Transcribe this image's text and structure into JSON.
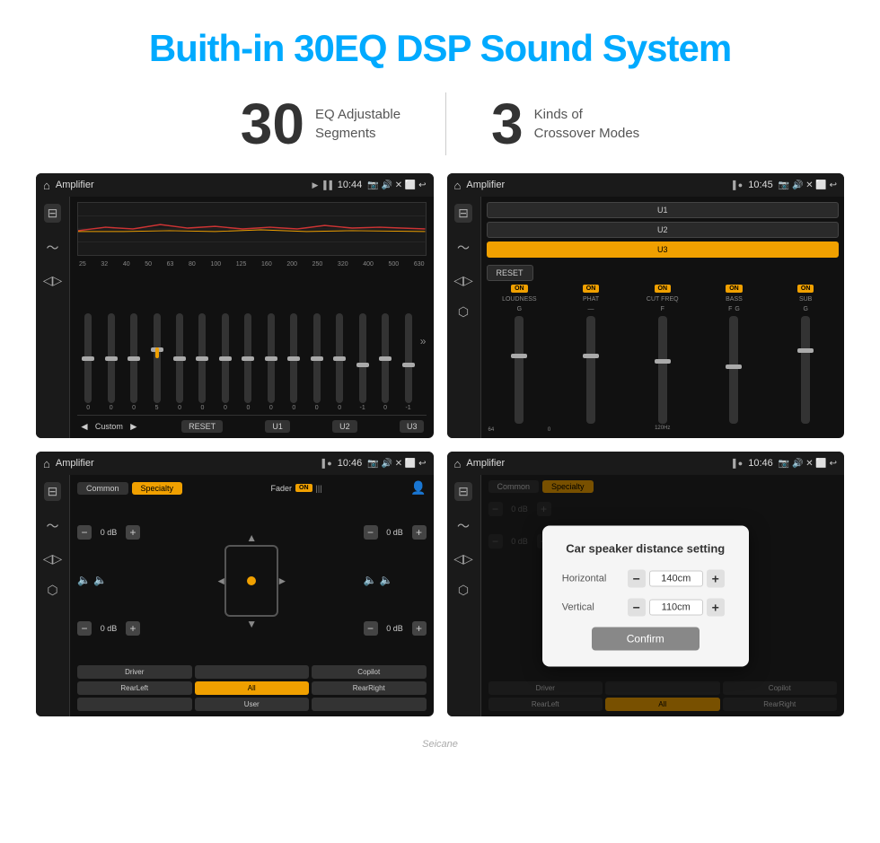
{
  "header": {
    "title": "Buith-in 30EQ DSP Sound System"
  },
  "stats": [
    {
      "number": "30",
      "text_line1": "EQ Adjustable",
      "text_line2": "Segments"
    },
    {
      "number": "3",
      "text_line1": "Kinds of",
      "text_line2": "Crossover Modes"
    }
  ],
  "screens": [
    {
      "id": "screen1",
      "topbar": {
        "title": "Amplifier",
        "time": "10:44"
      },
      "type": "eq",
      "eq_labels": [
        "25",
        "32",
        "40",
        "50",
        "63",
        "80",
        "100",
        "125",
        "160",
        "200",
        "250",
        "320",
        "400",
        "500",
        "630"
      ],
      "eq_values": [
        "0",
        "0",
        "0",
        "5",
        "0",
        "0",
        "0",
        "0",
        "0",
        "0",
        "0",
        "0",
        "-1",
        "0",
        "-1"
      ],
      "bottom_text": "Custom",
      "bottom_btns": [
        "RESET",
        "U1",
        "U2",
        "U3"
      ]
    },
    {
      "id": "screen2",
      "topbar": {
        "title": "Amplifier",
        "time": "10:45"
      },
      "type": "amp",
      "presets": [
        "U1",
        "U2",
        "U3"
      ],
      "active_preset": "U3",
      "channels": [
        {
          "label": "LOUDNESS",
          "on": true
        },
        {
          "label": "PHAT",
          "on": true
        },
        {
          "label": "CUT FREQ",
          "on": true
        },
        {
          "label": "BASS",
          "on": true
        },
        {
          "label": "SUB",
          "on": true
        }
      ],
      "reset_label": "RESET"
    },
    {
      "id": "screen3",
      "topbar": {
        "title": "Amplifier",
        "time": "10:46"
      },
      "type": "fader",
      "tabs": [
        "Common",
        "Specialty"
      ],
      "active_tab": "Specialty",
      "fader_label": "Fader",
      "fader_on": "ON",
      "controls": [
        {
          "label": "0 dB",
          "side": "left"
        },
        {
          "label": "0 dB",
          "side": "right"
        },
        {
          "label": "0 dB",
          "side": "left2"
        },
        {
          "label": "0 dB",
          "side": "right2"
        }
      ],
      "bottom_btns": [
        "Driver",
        "RearLeft",
        "All",
        "User",
        "Copilot",
        "RearRight"
      ],
      "active_btn": "All"
    },
    {
      "id": "screen4",
      "topbar": {
        "title": "Amplifier",
        "time": "10:46"
      },
      "type": "dist",
      "dialog_title": "Car speaker distance setting",
      "horizontal_label": "Horizontal",
      "horizontal_value": "140cm",
      "vertical_label": "Vertical",
      "vertical_value": "110cm",
      "confirm_label": "Confirm",
      "bottom_btns": [
        "Driver",
        "RearLeft",
        "All",
        "Copilot",
        "RearRight"
      ]
    }
  ],
  "footer": {
    "brand": "Seicane"
  },
  "icons": {
    "home": "⌂",
    "back": "↩",
    "camera": "📷",
    "volume": "🔊",
    "settings": "≡",
    "eq_bars": "≋",
    "waveform": "〜",
    "speaker": "🔊",
    "bluetooth": "⬡",
    "up": "▲",
    "down": "▼",
    "left": "◄",
    "right": "►",
    "minus": "−",
    "plus": "+"
  }
}
